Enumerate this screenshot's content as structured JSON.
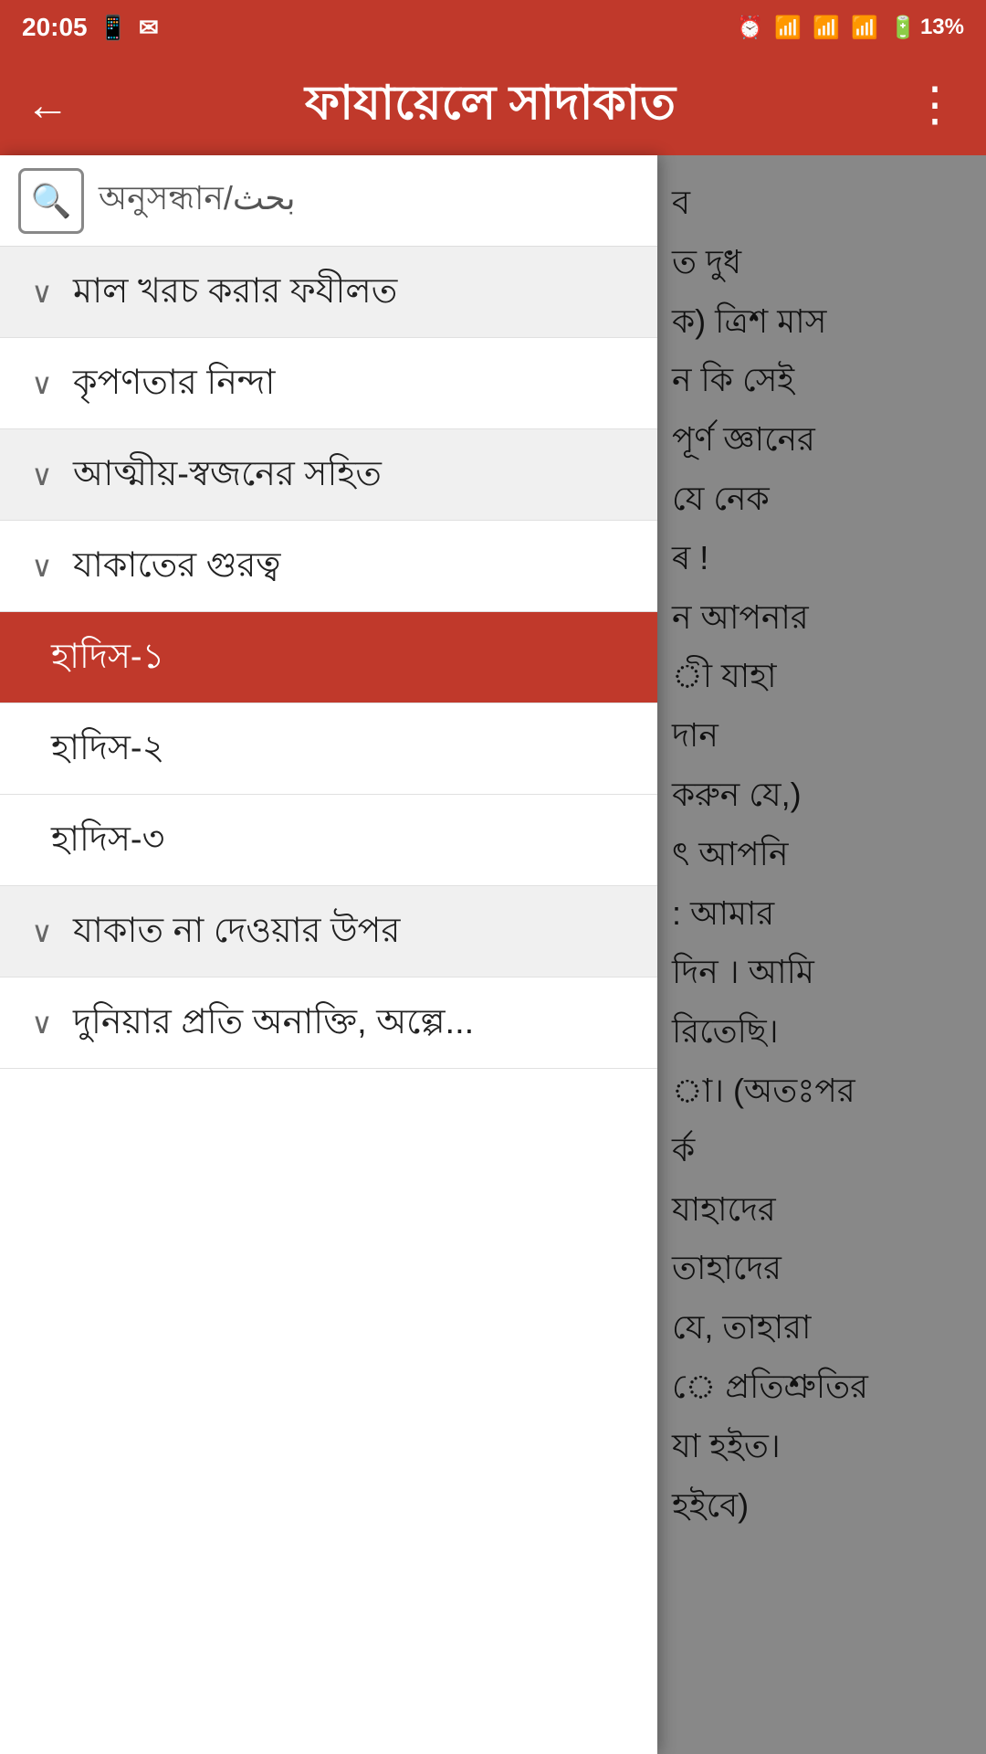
{
  "statusBar": {
    "time": "20:05",
    "battery": "13%"
  },
  "appBar": {
    "title": "ফাযায়েলে সাদাকাত",
    "backLabel": "←",
    "moreLabel": "⋮"
  },
  "search": {
    "placeholder": "অনুসন্ধান/بحث",
    "iconLabel": "🔍"
  },
  "menuItems": [
    {
      "id": "mal-khoroch",
      "label": "মাল খরচ করার ফযীলত",
      "hasChevron": true,
      "active": false,
      "sub": false,
      "altBg": true
    },
    {
      "id": "kuponta",
      "label": "কৃপণতার নিন্দা",
      "hasChevron": true,
      "active": false,
      "sub": false,
      "altBg": false
    },
    {
      "id": "atmio",
      "label": "আত্মীয়-স্বজনের সহিত",
      "hasChevron": true,
      "active": false,
      "sub": false,
      "altBg": true
    },
    {
      "id": "jakaater-gurutto",
      "label": "যাকাতের গুরত্ব",
      "hasChevron": true,
      "active": false,
      "sub": false,
      "altBg": false
    },
    {
      "id": "hadis-1",
      "label": "হাদিস-১",
      "hasChevron": false,
      "active": true,
      "sub": true,
      "altBg": false
    },
    {
      "id": "hadis-2",
      "label": "হাদিস-২",
      "hasChevron": false,
      "active": false,
      "sub": true,
      "altBg": false
    },
    {
      "id": "hadis-3",
      "label": "হাদিস-৩",
      "hasChevron": false,
      "active": false,
      "sub": true,
      "altBg": false
    },
    {
      "id": "jaakat-na",
      "label": "যাকাত না দেওয়ার উপর",
      "hasChevron": true,
      "active": false,
      "sub": false,
      "altBg": true
    },
    {
      "id": "duniya",
      "label": "দুনিয়ার প্রতি অনাক্তি, অল্পে...",
      "hasChevron": true,
      "active": false,
      "sub": false,
      "altBg": false
    }
  ],
  "contentLines": [
    "ব",
    "ত দুধ",
    "ক) ত্রিশ মাস",
    "ন কি সেই",
    "পূর্ণ জ্ঞানের",
    "যে নেক",
    "ৰ !",
    "ন আপনার",
    "ী যাহা",
    "দান",
    "করুন যে,)",
    "ৎ আপনি",
    ": আমার",
    "দিন । আমি",
    "রিতেছি।",
    "া। (অতঃপর",
    "র্ক",
    "যাহাদের",
    "তাহাদের",
    "যে, তাহারা",
    "ে প্রতিশ্রুতির",
    "যা হইত।",
    "হইবে)"
  ]
}
